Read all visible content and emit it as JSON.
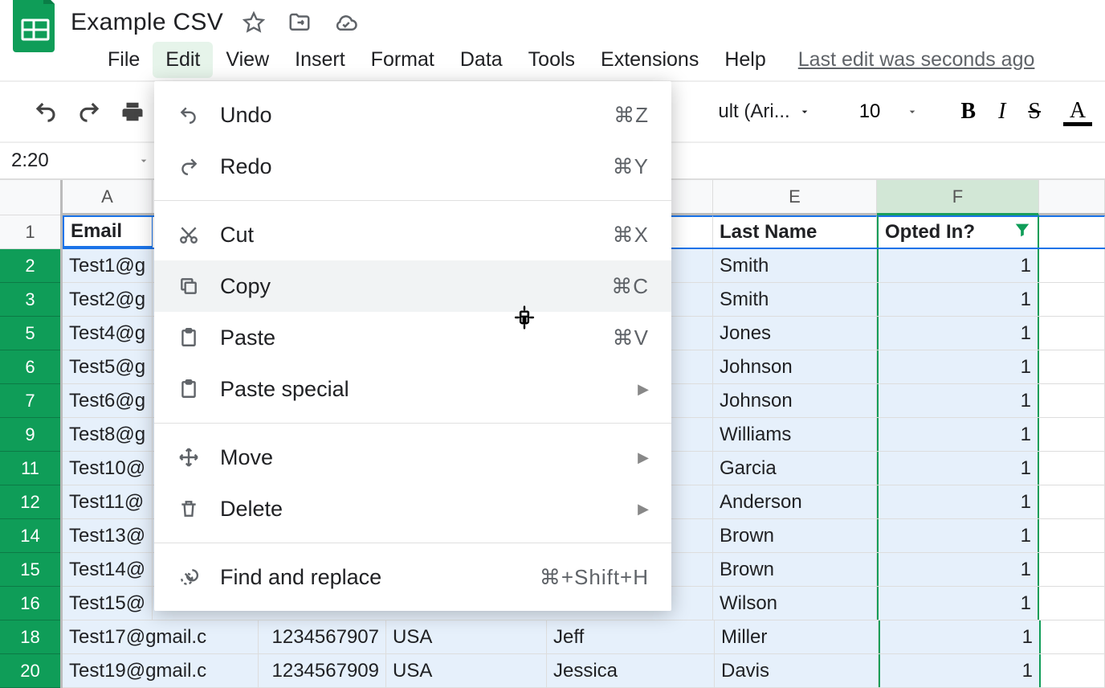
{
  "title": "Example CSV",
  "menus": [
    "File",
    "Edit",
    "View",
    "Insert",
    "Format",
    "Data",
    "Tools",
    "Extensions",
    "Help"
  ],
  "active_menu": "Edit",
  "last_edit": "Last edit was seconds ago",
  "font_name": "ult (Ari...",
  "font_size": "10",
  "namebox": "2:20",
  "col_labels": {
    "A": "A",
    "E": "E",
    "F": "F"
  },
  "headers": {
    "email": "Email",
    "lastname": "Last Name",
    "opted": "Opted In?"
  },
  "row_numbers": [
    "1",
    "2",
    "3",
    "5",
    "6",
    "7",
    "9",
    "11",
    "12",
    "14",
    "15",
    "16",
    "18",
    "20"
  ],
  "rows": [
    {
      "email": "Test1@g",
      "last": "Smith",
      "opt": "1"
    },
    {
      "email": "Test2@g",
      "last": "Smith",
      "opt": "1"
    },
    {
      "email": "Test4@g",
      "last": "Jones",
      "opt": "1"
    },
    {
      "email": "Test5@g",
      "last": "Johnson",
      "opt": "1"
    },
    {
      "email": "Test6@g",
      "last": "Johnson",
      "opt": "1"
    },
    {
      "email": "Test8@g",
      "last": "Williams",
      "opt": "1"
    },
    {
      "email": "Test10@",
      "last": "Garcia",
      "opt": "1"
    },
    {
      "email": "Test11@",
      "last": "Anderson",
      "opt": "1"
    },
    {
      "email": "Test13@",
      "last": "Brown",
      "opt": "1"
    },
    {
      "email": "Test14@",
      "last": "Brown",
      "opt": "1"
    },
    {
      "email": "Test15@",
      "last": "Wilson",
      "opt": "1"
    },
    {
      "email": "Test17@gmail.c",
      "phone": "1234567907",
      "country": "USA",
      "first": "Jeff",
      "last": "Miller",
      "opt": "1"
    },
    {
      "email": "Test19@gmail.c",
      "phone": "1234567909",
      "country": "USA",
      "first": "Jessica",
      "last": "Davis",
      "opt": "1"
    }
  ],
  "dropdown": [
    {
      "icon": "undo",
      "label": "Undo",
      "short": "⌘Z"
    },
    {
      "icon": "redo",
      "label": "Redo",
      "short": "⌘Y"
    },
    {
      "sep": true
    },
    {
      "icon": "cut",
      "label": "Cut",
      "short": "⌘X"
    },
    {
      "icon": "copy",
      "label": "Copy",
      "short": "⌘C",
      "hover": true
    },
    {
      "icon": "paste",
      "label": "Paste",
      "short": "⌘V"
    },
    {
      "icon": "paste",
      "label": "Paste special",
      "chev": true
    },
    {
      "sep": true
    },
    {
      "icon": "move",
      "label": "Move",
      "chev": true
    },
    {
      "icon": "delete",
      "label": "Delete",
      "chev": true
    },
    {
      "sep": true
    },
    {
      "icon": "find",
      "label": "Find and replace",
      "short": "⌘+Shift+H"
    }
  ]
}
